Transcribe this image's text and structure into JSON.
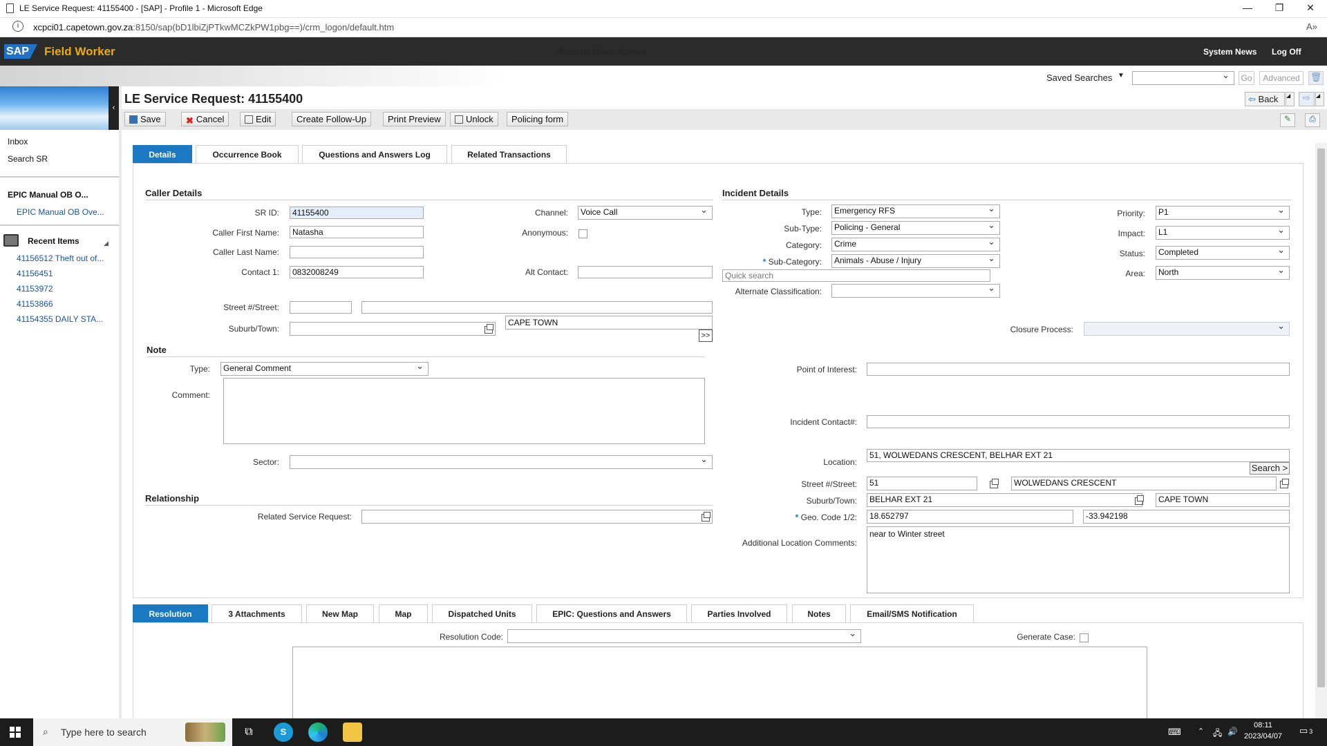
{
  "browser": {
    "title": "LE Service Request: 41155400 - [SAP] - Profile 1 - Microsoft Edge",
    "url_host": "xcpci01.capetown.gov.za",
    "url_path": ":8150/sap(bD1lbiZjPTkwMCZkPW1pbg==)/crm_logon/default.htm"
  },
  "sap": {
    "logo": "SAP",
    "app_name": "Field Worker",
    "welcome": "Welcome Morne Koeries",
    "system_news": "System News",
    "log_off": "Log Off"
  },
  "header": {
    "saved_searches": "Saved Searches",
    "go": "Go",
    "advanced": "Advanced",
    "back": "Back",
    "page_title": "LE Service Request: 41155400"
  },
  "toolbar": {
    "save": "Save",
    "cancel": "Cancel",
    "edit": "Edit",
    "create_followup": "Create Follow-Up",
    "print_preview": "Print Preview",
    "unlock": "Unlock",
    "policing_form": "Policing form"
  },
  "sidebar": {
    "inbox": "Inbox",
    "search_sr": "Search SR",
    "epic_head": "EPIC Manual OB O...",
    "epic_link": "EPIC Manual OB Ove...",
    "recent_title": "Recent Items",
    "recent": [
      "41156512 Theft out of...",
      "41156451",
      "41153972",
      "41153866",
      "41154355 DAILY STA..."
    ]
  },
  "tabs_top": [
    "Details",
    "Occurrence Book",
    "Questions and Answers Log",
    "Related Transactions"
  ],
  "caller": {
    "section": "Caller Details",
    "sr_id_label": "SR ID:",
    "sr_id": "41155400",
    "channel_label": "Channel:",
    "channel": "Voice Call",
    "first_label": "Caller First Name:",
    "first": "Natasha",
    "anon_label": "Anonymous:",
    "last_label": "Caller Last Name:",
    "last": "",
    "contact_label": "Contact 1:",
    "contact": "0832008249",
    "alt_label": "Alt Contact:",
    "alt": "",
    "street_label": "Street #/Street:",
    "suburb_label": "Suburb/Town:",
    "town": "CAPE TOWN",
    "more": ">>"
  },
  "note": {
    "section": "Note",
    "type_label": "Type:",
    "type": "General Comment",
    "comment_label": "Comment:",
    "sector_label": "Sector:"
  },
  "relationship": {
    "section": "Relationship",
    "related_label": "Related Service Request:"
  },
  "incident": {
    "section": "Incident Details",
    "type_label": "Type:",
    "type": "Emergency RFS",
    "subtype_label": "Sub-Type:",
    "subtype": "Policing - General",
    "category_label": "Category:",
    "category": "Crime",
    "subcat_label": "Sub-Category:",
    "subcat": "Animals - Abuse / Injury",
    "quick_search": "Quick search",
    "alt_class_label": "Alternate Classification:",
    "priority_label": "Priority:",
    "priority": "P1",
    "impact_label": "Impact:",
    "impact": "L1",
    "status_label": "Status:",
    "status": "Completed",
    "area_label": "Area:",
    "area": "North",
    "closure_label": "Closure Process:",
    "poi_label": "Point of Interest:",
    "contact_label": "Incident Contact#:",
    "location_label": "Location:",
    "location": "51, WOLWEDANS CRESCENT, BELHAR EXT 21",
    "search_btn": "Search >",
    "street_label": "Street #/Street:",
    "street_no": "51",
    "street": "WOLWEDANS CRESCENT",
    "suburb_label": "Suburb/Town:",
    "suburb": "BELHAR EXT 21",
    "town": "CAPE TOWN",
    "geo_label": "Geo. Code 1/2:",
    "geo1": "18.652797",
    "geo2": "-33.942198",
    "addl_label": "Additional Location Comments:",
    "addl": "near to Winter street"
  },
  "tabs_bottom": [
    "Resolution",
    "3 Attachments",
    "New Map",
    "Map",
    "Dispatched Units",
    "EPIC: Questions and Answers",
    "Parties Involved",
    "Notes",
    "Email/SMS Notification"
  ],
  "resolution": {
    "code_label": "Resolution Code:",
    "generate_label": "Generate Case:"
  },
  "taskbar": {
    "search": "Type here to search",
    "time": "08:11",
    "date": "2023/04/07",
    "notif": "3"
  }
}
